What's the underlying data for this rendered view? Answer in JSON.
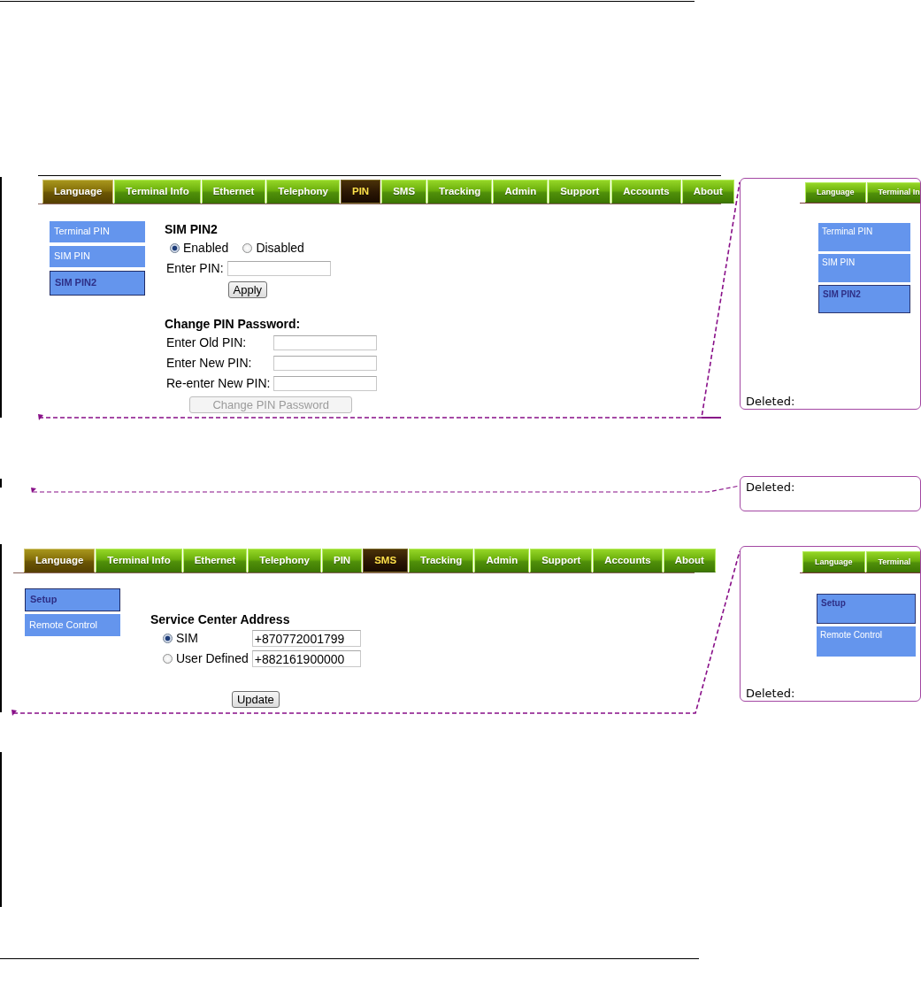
{
  "screenshots": [
    {
      "tabs": [
        {
          "label": "Language",
          "selected": false,
          "highlighted": true
        },
        {
          "label": "Terminal Info",
          "selected": false,
          "highlighted": false
        },
        {
          "label": "Ethernet",
          "selected": false,
          "highlighted": false
        },
        {
          "label": "Telephony",
          "selected": false,
          "highlighted": false
        },
        {
          "label": "PIN",
          "selected": true,
          "highlighted": false
        },
        {
          "label": "SMS",
          "selected": false,
          "highlighted": false
        },
        {
          "label": "Tracking",
          "selected": false,
          "highlighted": false
        },
        {
          "label": "Admin",
          "selected": false,
          "highlighted": false
        },
        {
          "label": "Support",
          "selected": false,
          "highlighted": false
        },
        {
          "label": "Accounts",
          "selected": false,
          "highlighted": false
        },
        {
          "label": "About",
          "selected": false,
          "highlighted": false
        }
      ],
      "sidebar": [
        {
          "label": "Terminal PIN",
          "selected": false
        },
        {
          "label": "SIM PIN",
          "selected": false
        },
        {
          "label": "SIM PIN2",
          "selected": true
        }
      ],
      "sections": [
        {
          "heading": "SIM PIN2",
          "rows": [
            {
              "kind": "radio_group",
              "options": [
                {
                  "label": "Enabled",
                  "selected": true
                },
                {
                  "label": "Disabled",
                  "selected": false
                }
              ]
            },
            {
              "kind": "field",
              "label": "Enter PIN:"
            }
          ],
          "button": {
            "label": "Apply",
            "disabled": false
          }
        },
        {
          "heading": "Change PIN Password:",
          "rows": [
            {
              "kind": "field",
              "label": "Enter Old PIN:"
            },
            {
              "kind": "field",
              "label": "Enter New PIN:"
            },
            {
              "kind": "field",
              "label": "Re-enter New PIN:"
            }
          ],
          "button": {
            "label": "Change PIN Password",
            "disabled": true
          }
        }
      ]
    },
    {
      "tabs": [
        {
          "label": "Language",
          "selected": false,
          "highlighted": true
        },
        {
          "label": "Terminal Info",
          "selected": false,
          "highlighted": false
        },
        {
          "label": "Ethernet",
          "selected": false,
          "highlighted": false
        },
        {
          "label": "Telephony",
          "selected": false,
          "highlighted": false
        },
        {
          "label": "PIN",
          "selected": false,
          "highlighted": false
        },
        {
          "label": "SMS",
          "selected": true,
          "highlighted": false
        },
        {
          "label": "Tracking",
          "selected": false,
          "highlighted": false
        },
        {
          "label": "Admin",
          "selected": false,
          "highlighted": false
        },
        {
          "label": "Support",
          "selected": false,
          "highlighted": false
        },
        {
          "label": "Accounts",
          "selected": false,
          "highlighted": false
        },
        {
          "label": "About",
          "selected": false,
          "highlighted": false
        }
      ],
      "sidebar": [
        {
          "label": "Setup",
          "selected": true
        },
        {
          "label": "Remote Control",
          "selected": false
        }
      ],
      "sections": [
        {
          "heading": "Service Center Address",
          "rows": [
            {
              "kind": "radio_field",
              "label": "SIM",
              "selected": true,
              "value": "+870772001799"
            },
            {
              "kind": "radio_field",
              "label": "User Defined",
              "selected": false,
              "value": "+882161900000"
            }
          ],
          "button": {
            "label": "Update",
            "disabled": false
          }
        }
      ]
    }
  ],
  "comments": [
    {
      "label": "Deleted:",
      "thumbnail": {
        "tabs": [
          {
            "label": "Language",
            "selected": false,
            "highlighted": false
          },
          {
            "label": "Terminal In",
            "selected": false,
            "highlighted": false
          }
        ],
        "sidebar": [
          {
            "label": "Terminal PIN",
            "selected": false
          },
          {
            "label": "SIM PIN",
            "selected": false
          },
          {
            "label": "SIM PIN2",
            "selected": true
          }
        ]
      }
    },
    {
      "label": "Deleted:"
    },
    {
      "label": "Deleted:",
      "thumbnail": {
        "tabs": [
          {
            "label": "Language",
            "selected": false,
            "highlighted": false
          },
          {
            "label": "Terminal",
            "selected": false,
            "highlighted": false
          }
        ],
        "sidebar": [
          {
            "label": "Setup",
            "selected": true
          },
          {
            "label": "Remote Control",
            "selected": false
          }
        ]
      }
    }
  ]
}
